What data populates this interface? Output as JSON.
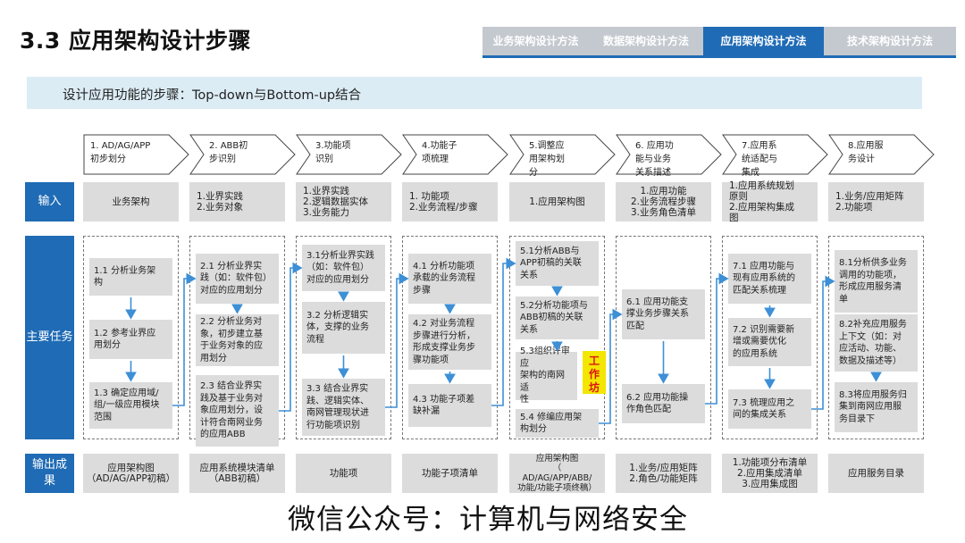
{
  "title": "3.3 应用架构设计步骤",
  "nav_tabs": [
    {
      "label": "业务架构设计方法",
      "active": false
    },
    {
      "label": "数据架构设计方法",
      "active": false
    },
    {
      "label": "应用架构设计方法",
      "active": true
    },
    {
      "label": "技术架构设计方法",
      "active": false
    }
  ],
  "subtitle": "设计应用功能的步骤：Top-down与Bottom-up结合",
  "row_labels": {
    "input": "输入",
    "tasks": "主要任务",
    "output": "输出成\n果"
  },
  "steps": [
    {
      "label": "1. AD/AG/APP\n初步划分"
    },
    {
      "label": "2. ABB初\n步识别"
    },
    {
      "label": "3.功能项\n识别"
    },
    {
      "label": "4.功能子\n项梳理"
    },
    {
      "label": "5.调整应\n用架构划\n分"
    },
    {
      "label": "6. 应用功\n能与业务\n关系描述"
    },
    {
      "label": "7.应用系\n统适配与\n集成"
    },
    {
      "label": "8.应用服\n务设计"
    }
  ],
  "inputs": [
    "业务架构",
    "1.业界实践\n2.业务对象",
    "1.业界实践\n2.逻辑数据实体\n3.业务能力",
    "1. 功能项\n2.业务流程/步骤",
    "1.应用架构图",
    "1.应用功能\n2.业务流程步骤\n3.业务角色清单",
    "1.应用系统规划\n原则\n2.应用架构集成\n图",
    "1.业务/应用矩阵\n2.功能项"
  ],
  "tasks": [
    [
      "1.1 分析业务架\n构",
      "1.2 参考业界应\n用划分",
      "1.3 确定应用域/\n组/一级应用模块\n范围"
    ],
    [
      "2.1 分析业界实\n践（如：软件包）\n对应的应用划分",
      "2.2 分析业务对\n象，初步建立基\n于业务对象的应\n用划分",
      "2.3 结合业界实\n践及基于业务对\n象应用划分，设\n计符合南网业务\n的应用ABB"
    ],
    [
      "3.1分析业界实践\n（如：软件包）\n对应的应用划分",
      "3.2 分析逻辑实\n体，支撑的业务\n流程",
      "3.3 结合业界实\n践、逻辑实体、\n南网管理现状进\n行功能项识别"
    ],
    [
      "4.1 分析功能项\n承载的业务流程\n步骤",
      "4.2 对业务流程\n步骤进行分析，\n形成支撑业务步\n骤功能项",
      "4.3 功能子项差\n缺补漏"
    ],
    [
      "5.1分析ABB与\nAPP初稿的关联\n关系",
      "5.2分析功能项与\nABB初稿的关联\n关系",
      "5.3组织评审应\n架构的南网适\n性",
      "5.4 修编应用架\n构划分"
    ],
    [
      "6.1 应用功能支\n撑业务步骤关系\n匹配",
      "6.2 应用功能操\n作角色匹配"
    ],
    [
      "7.1 应用功能与\n现有应用系统的\n匹配关系梳理",
      "7.2 识别需要新\n增或需要优化\n的应用系统",
      "7.3 梳理应用之\n间的集成关系"
    ],
    [
      "8.1分析供多业务\n调用的功能项，\n形成应用服务清\n单",
      "8.2补充应用服务\n上下文（如：对\n应活动、功能、\n数据及描述等）",
      "8.3将应用服务归\n集到南网应用服\n务目录下"
    ]
  ],
  "workshop_stamp": "工\n作\n坊",
  "outputs": [
    "应用架构图\n（AD/AG/APP初稿）",
    "应用系统模块清单\n（ABB初稿）",
    "功能项",
    "功能子项清单",
    "应用架构图\n（\nAD/AG/APP/ABB/\n功能/功能子项终稿）",
    "1.业务/应用矩阵\n2.角色/功能矩阵",
    "1.功能项分布清单\n2.应用集成清单\n3.应用集成图",
    "应用服务目录"
  ],
  "watermark": "微信公众号：计算机与网络安全",
  "colors": {
    "accent": "#1f6bb5",
    "tab_inactive": "#c4c9cf",
    "band": "#dcecf5",
    "box_grey": "#dcdcdc",
    "arrow": "#3d8fd6",
    "stamp_bg": "#f3e600",
    "stamp_text": "#dd1111"
  }
}
